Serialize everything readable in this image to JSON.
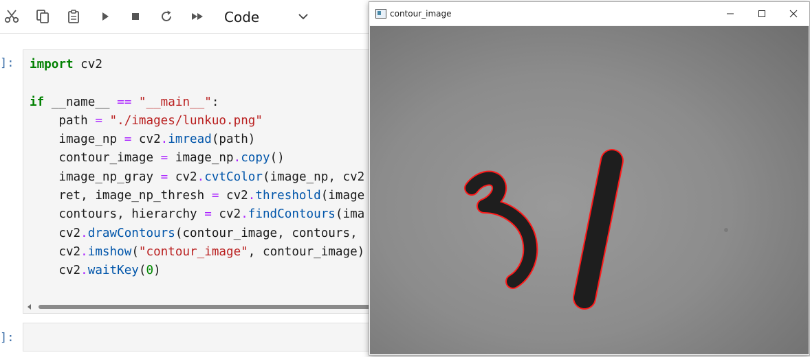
{
  "toolbar": {
    "buttons": [
      "scissors-icon",
      "copy-icon",
      "clipboard-icon",
      "run-icon",
      "stop-icon",
      "restart-icon",
      "fast-forward-icon"
    ],
    "cell_type_value": "Code"
  },
  "cells": [
    {
      "prompt": "]:",
      "code_lines": [
        "import cv2",
        "",
        "if __name__ == \"__main__\":",
        "    path = \"./images/lunkuo.png\"",
        "    image_np = cv2.imread(path)",
        "    contour_image = image_np.copy()",
        "    image_np_gray = cv2.cvtColor(image_np, cv2",
        "    ret, image_np_thresh = cv2.threshold(image",
        "    contours, hierarchy = cv2.findContours(ima",
        "    cv2.drawContours(contour_image, contours,",
        "    cv2.imshow(\"contour_image\", contour_image)",
        "    cv2.waitKey(0)"
      ]
    },
    {
      "prompt": "]:",
      "code_lines": []
    }
  ],
  "image_window": {
    "title": "contour_image",
    "controls": [
      "minimize-icon",
      "maximize-icon",
      "close-icon"
    ],
    "content": "handwritten digits 3 and 1 outlined with red contours on gray background",
    "contour_color": "#ff1a1a",
    "background_color": "#8a8a8a",
    "stroke_color": "#1e1e1e"
  }
}
